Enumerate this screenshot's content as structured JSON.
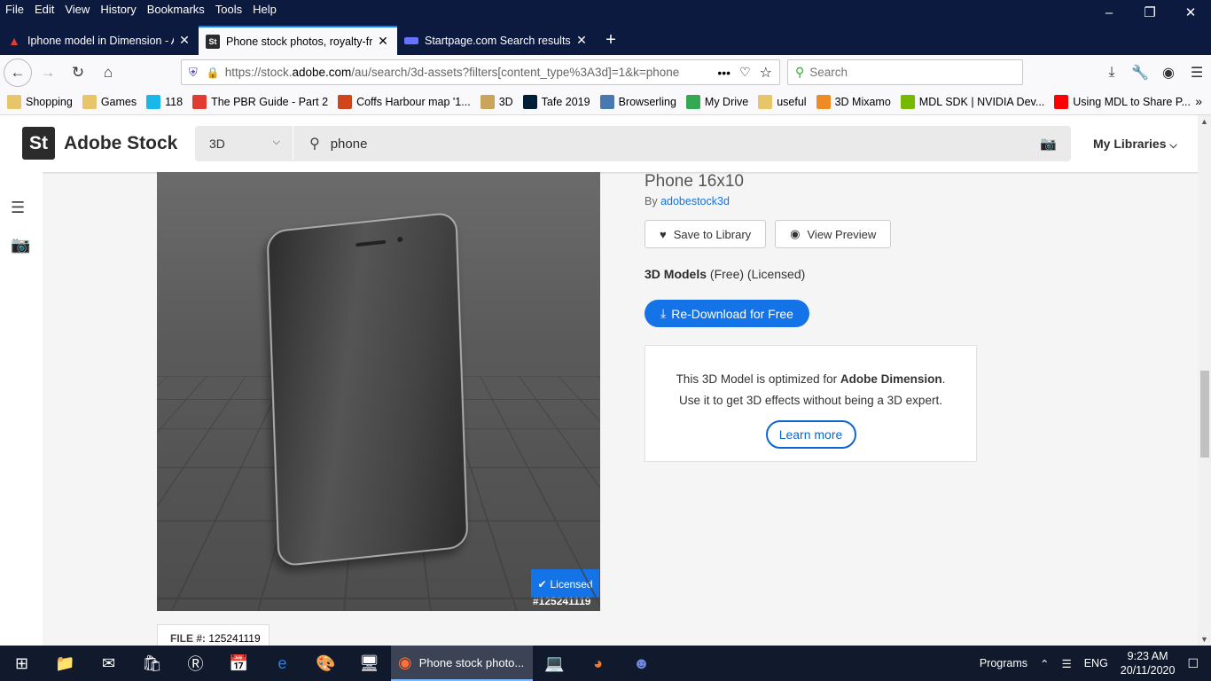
{
  "browser": {
    "menu": [
      "File",
      "Edit",
      "View",
      "History",
      "Bookmarks",
      "Tools",
      "Help"
    ],
    "tabs": [
      {
        "title": "Iphone model in Dimension - A",
        "icon": "adobe-icon"
      },
      {
        "title": "Phone stock photos, royalty-fre",
        "icon": "stock-icon"
      },
      {
        "title": "Startpage.com Search results",
        "icon": "startpage-icon"
      }
    ],
    "url_prefix": "https://stock.",
    "url_domain": "adobe.com",
    "url_rest": "/au/search/3d-assets?filters[content_type%3A3d]=1&k=phone",
    "search_placeholder": "Search",
    "bookmarks": [
      {
        "label": "Shopping",
        "icon": "folder-icon",
        "color": "#e8c46a"
      },
      {
        "label": "Games",
        "icon": "folder-icon",
        "color": "#e8c46a"
      },
      {
        "label": "118",
        "icon": "vimeo-icon",
        "color": "#1ab7ea"
      },
      {
        "label": "The PBR Guide - Part 2",
        "icon": "substance-icon",
        "color": "#e03c31"
      },
      {
        "label": "Coffs Harbour map '1...",
        "icon": "map-icon",
        "color": "#d0451b"
      },
      {
        "label": "3D",
        "icon": "image-folder-icon",
        "color": "#c9a45a"
      },
      {
        "label": "Tafe 2019",
        "icon": "lightroom-icon",
        "color": "#001e36"
      },
      {
        "label": "Browserling",
        "icon": "browserling-icon",
        "color": "#4a78b0"
      },
      {
        "label": "My Drive",
        "icon": "drive-icon",
        "color": "#34a853"
      },
      {
        "label": "useful",
        "icon": "folder-icon",
        "color": "#e8c46a"
      },
      {
        "label": "3D Mixamo",
        "icon": "mixamo-icon",
        "color": "#f08a24"
      },
      {
        "label": "MDL SDK | NVIDIA Dev...",
        "icon": "nvidia-icon",
        "color": "#76b900"
      },
      {
        "label": "Using MDL to Share P...",
        "icon": "youtube-icon",
        "color": "#ff0000"
      }
    ]
  },
  "stock": {
    "logo_mark": "St",
    "logo_name": "Adobe Stock",
    "category": "3D",
    "query": "phone",
    "my_libraries": "My Libraries",
    "asset": {
      "title": "Phone 16x10",
      "by_prefix": "By",
      "author": "adobestock3d",
      "save_label": "Save to Library",
      "preview_label": "View Preview",
      "license_type": "3D Models",
      "license_free": "(Free)",
      "license_status": "(Licensed)",
      "download_label": "Re-Download for Free",
      "licensed_badge": "Licensed",
      "asset_id": "#125241119",
      "file_label": "FILE #:",
      "file_number": "125241119"
    },
    "info": {
      "line1_pre": "This 3D Model is optimized for",
      "line1_bold": "Adobe Dimension",
      "line1_post": ".",
      "line2": "Use it to get 3D effects without being a 3D expert.",
      "learn_more": "Learn more"
    }
  },
  "taskbar": {
    "active_app": "Phone stock photo...",
    "programs": "Programs",
    "lang": "ENG",
    "time": "9:23 AM",
    "date": "20/11/2020"
  },
  "colors": {
    "accent": "#1473e6",
    "titlebar": "#0c1a3f"
  }
}
